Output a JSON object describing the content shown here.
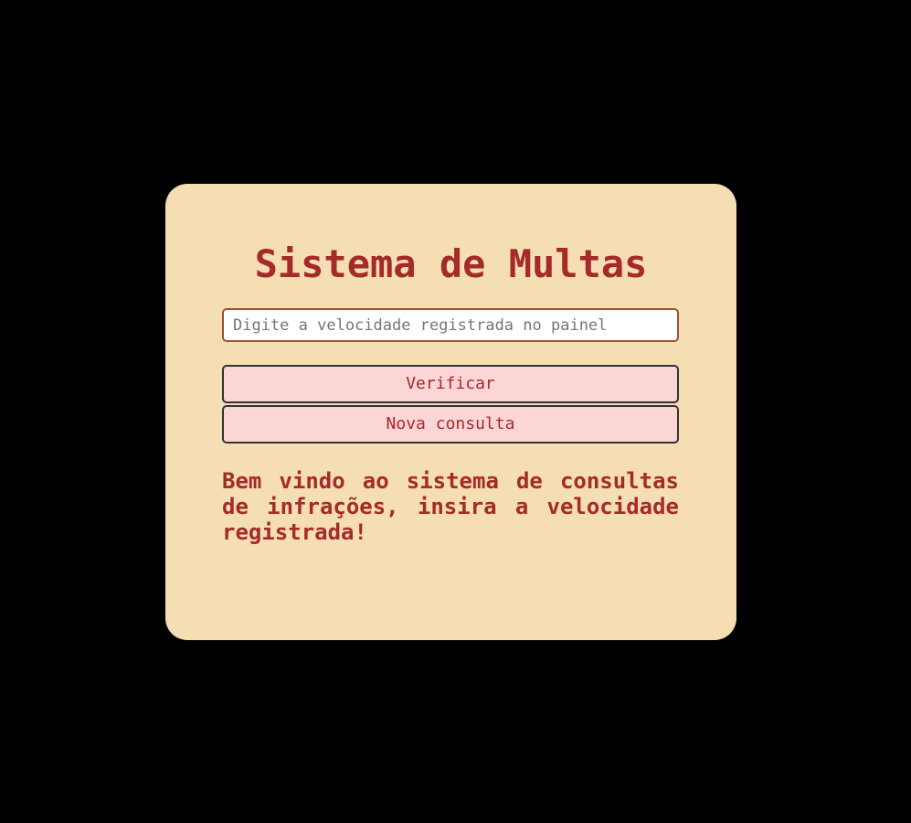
{
  "app": {
    "title": "Sistema de Multas"
  },
  "form": {
    "speed_placeholder": "Digite a velocidade registrada no painel",
    "speed_value": "",
    "verify_label": "Verificar",
    "new_query_label": "Nova consulta"
  },
  "status": {
    "message": "Bem vindo ao sistema de consultas de infrações, insira a velocidade registrada!"
  },
  "colors": {
    "background": "#000000",
    "card": "#f5deb3",
    "accent_text": "#a52a2a",
    "button_fill": "#fcd5d7",
    "input_border": "#a0522d"
  }
}
